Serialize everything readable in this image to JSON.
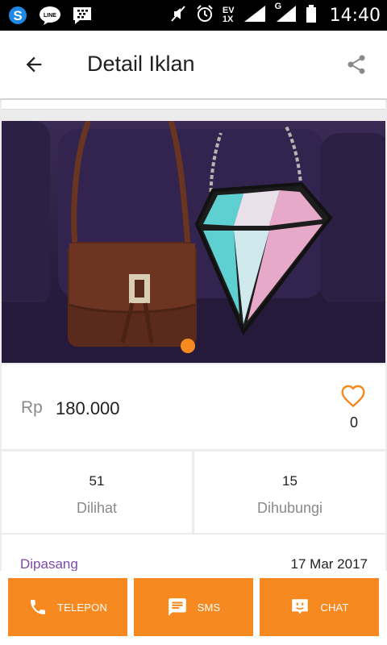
{
  "status_bar": {
    "time": "14:40",
    "network_ev": "EV",
    "network_1x": "1X",
    "network_g": "G",
    "icons": [
      "s-app-icon",
      "line-icon",
      "bbm-icon",
      "mute-icon",
      "alarm-icon",
      "signal-icon",
      "battery-icon"
    ]
  },
  "header": {
    "title": "Detail Iklan",
    "back_icon": "arrow-left-icon",
    "share_icon": "share-icon"
  },
  "listing": {
    "image_description": "brown leather bag and diamond shaped bag on purple sofa",
    "image_count_dot_color": "#f6891f",
    "currency": "Rp",
    "price": "180.000",
    "favorite_count": "0"
  },
  "stats": {
    "views": {
      "value": "51",
      "label": "Dilihat"
    },
    "contacted": {
      "value": "15",
      "label": "Dihubungi"
    }
  },
  "posted": {
    "label": "Dipasang",
    "date": "17 Mar 2017"
  },
  "actions": {
    "phone": "TELEPON",
    "sms": "SMS",
    "chat": "CHAT"
  },
  "colors": {
    "accent": "#f6891f",
    "posted_label": "#7b4aa8"
  }
}
